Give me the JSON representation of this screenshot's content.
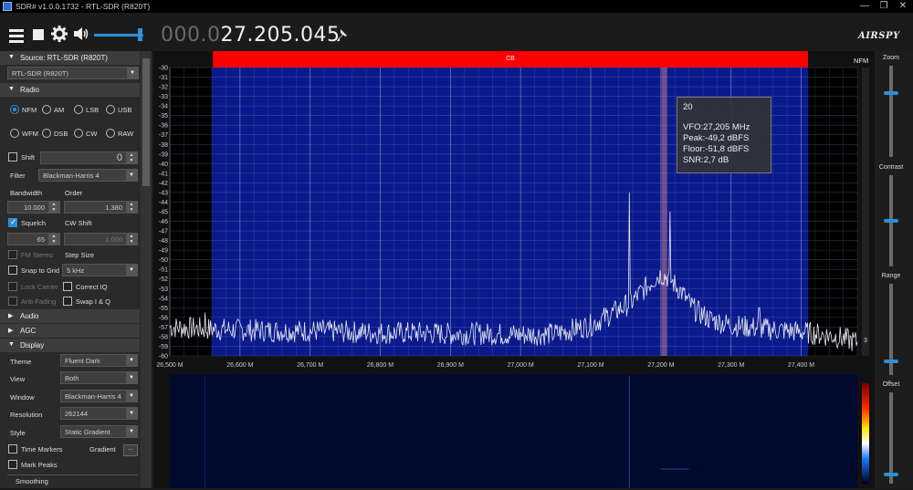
{
  "window": {
    "title": "SDR# v1.0.0.1732 - RTL-SDR (R820T)",
    "minimize": "—",
    "maximize": "❐",
    "close": "✕"
  },
  "toolbar": {
    "freq_dim": "000.0",
    "freq_lit": "27.205.045",
    "brand": "AIRSPY",
    "volume": 0.92
  },
  "sidebar": {
    "source": {
      "header": "Source: RTL-SDR (R820T)",
      "device": "RTL-SDR (R820T)"
    },
    "radio": {
      "header": "Radio",
      "modes": [
        "NFM",
        "AM",
        "LSB",
        "USB",
        "WFM",
        "DSB",
        "CW",
        "RAW"
      ],
      "selected_mode": "NFM",
      "shift_label": "Shift",
      "shift_value": "0",
      "filter_label": "Filter",
      "filter_value": "Blackman-Harris 4",
      "bandwidth_label": "Bandwidth",
      "order_label": "Order",
      "bandwidth_value": "10.000",
      "order_value": "1.380",
      "squelch_label": "Squelch",
      "cw_shift_label": "CW Shift",
      "squelch_value": "65",
      "cw_shift_value": "1.000",
      "fm_stereo_label": "FM Stereo",
      "step_size_label": "Step Size",
      "snap_label": "Snap to Grid",
      "step_value": "5 kHz",
      "lock_carrier_label": "Lock Carrier",
      "correct_iq_label": "Correct IQ",
      "anti_fading_label": "Anti-Fading",
      "swap_iq_label": "Swap I & Q"
    },
    "audio": {
      "header": "Audio"
    },
    "agc": {
      "header": "AGC"
    },
    "display": {
      "header": "Display",
      "theme_label": "Theme",
      "theme_value": "Fluent Dark",
      "view_label": "View",
      "view_value": "Both",
      "window_label": "Window",
      "window_value": "Blackman-Harris 4",
      "resolution_label": "Resolution",
      "resolution_value": "262144",
      "style_label": "Style",
      "style_value": "Static Gradient",
      "time_markers_label": "Time Markers",
      "gradient_label": "Gradient",
      "gradient_button": "...",
      "mark_peaks_label": "Mark Peaks",
      "smoothing_label": "Smoothing"
    }
  },
  "spectrum": {
    "band_label": "CB",
    "mode_label": "NFM",
    "corner_value": "3",
    "tooltip": {
      "channel": "20",
      "vfo": "VFO:27,205 MHz",
      "peak": "Peak:-49,2 dBFS",
      "floor": "Floor:-51,8 dBFS",
      "snr": "SNR:2,7 dB"
    }
  },
  "right_panel": {
    "zoom_label": "Zoom",
    "contrast_label": "Contrast",
    "range_label": "Range",
    "offset_label": "Offset",
    "zoom_level": 0.7,
    "contrast_level": 0.5,
    "range_level": 0.15,
    "offset_level": 0.1
  },
  "colors": {
    "accent": "#2d8fd8",
    "band_plan": "#ff0000",
    "band_fill": "#0a1a8c",
    "background": "#1b1b1b"
  },
  "chart_data": {
    "type": "line",
    "title": "",
    "xlabel": "",
    "ylabel": "",
    "x_ticks": [
      "26,500 M",
      "26,600 M",
      "26,700 M",
      "26,800 M",
      "26,900 M",
      "27,000 M",
      "27,100 M",
      "27,200 M",
      "27,300 M",
      "27,400 M"
    ],
    "x_tick_values": [
      26.5,
      26.6,
      26.7,
      26.8,
      26.9,
      27.0,
      27.1,
      27.2,
      27.3,
      27.4
    ],
    "xlim": [
      26.5,
      27.48
    ],
    "y_ticks": [
      "-30",
      "-31",
      "-32",
      "-33",
      "-34",
      "-35",
      "-36",
      "-37",
      "-38",
      "-39",
      "-40",
      "-41",
      "-42",
      "-43",
      "-44",
      "-45",
      "-46",
      "-47",
      "-48",
      "-49",
      "-50",
      "-51",
      "-52",
      "-53",
      "-54",
      "-55",
      "-56",
      "-57",
      "-58",
      "-59",
      "-60"
    ],
    "ylim": [
      -60,
      -30
    ],
    "band_range": [
      26.56,
      27.41
    ],
    "vfo_mhz": 27.205,
    "series": [
      {
        "x": [
          26.5,
          26.55,
          26.6,
          26.65,
          26.7,
          26.75,
          26.8,
          26.85,
          26.9,
          26.95,
          27.0,
          27.05,
          27.1,
          27.12,
          27.14,
          27.16,
          27.17,
          27.18,
          27.19,
          27.2,
          27.21,
          27.22,
          27.23,
          27.24,
          27.25,
          27.27,
          27.3,
          27.35,
          27.4,
          27.45,
          27.48
        ],
        "y": [
          -57.0,
          -57.2,
          -57.3,
          -57.4,
          -57.4,
          -57.5,
          -57.6,
          -57.6,
          -57.7,
          -57.7,
          -57.8,
          -57.7,
          -56.8,
          -56.0,
          -55.2,
          -54.3,
          -53.5,
          -52.8,
          -52.0,
          -51.5,
          -51.8,
          -52.6,
          -53.4,
          -54.5,
          -55.3,
          -56.2,
          -56.8,
          -57.2,
          -57.5,
          -58.0,
          -58.6
        ]
      }
    ],
    "spikes": [
      {
        "x": 27.155,
        "y": -43.0
      },
      {
        "x": 27.213,
        "y": -45.0
      },
      {
        "x": 27.34,
        "y": -55.0
      },
      {
        "x": 26.55,
        "y": -55.5
      }
    ]
  }
}
